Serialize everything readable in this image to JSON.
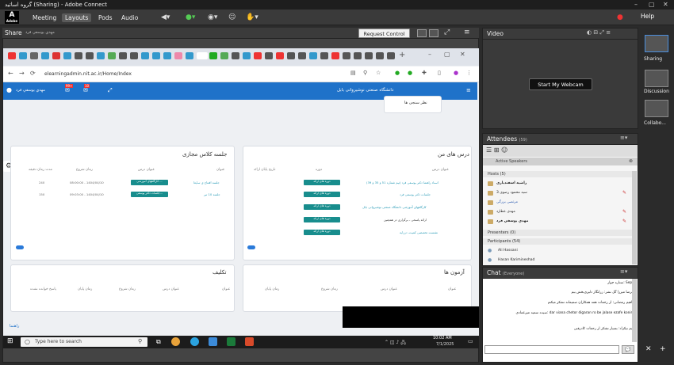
{
  "window": {
    "title": "گروه اساتید (Sharing) - Adobe Connect"
  },
  "app": {
    "logo": "Adobe"
  },
  "menu": {
    "meeting": "Meeting",
    "layouts": "Layouts",
    "pods": "Pods",
    "audio": "Audio",
    "help": "Help"
  },
  "share": {
    "title": "Share",
    "presenter": "مهدي یوسفي فرد",
    "request_control": "Request Control"
  },
  "browser": {
    "url": "elearningadmin.nit.ac.ir/Home/Index",
    "site_name": "دانشگاه صنعتی نوشیروانی بابل",
    "user_name": "مهدي يوسفي فرد",
    "badge_1": "99+",
    "badge_2": "10",
    "dropdown": "نظر سنجی ها"
  },
  "my_lessons": {
    "title": "درس های من",
    "headers": [
      "عنوان درس",
      "دوره",
      "تاریخ پایان ارائه"
    ],
    "rows": [
      "اسناد راهنما دکتر یوسفی فرد (تیم شماره 51 و 35 و 39)",
      "جلسات دکتر یوسفی فرد",
      "کارگاههای آموزشی دانشگاه صنعتی نوشیروانی بابل",
      "ارائه پاسخی - برگزاری در همچنین",
      "نشست تخصصی کمیت، درزایه"
    ],
    "button": "دوره های ارائه"
  },
  "virtual_class": {
    "title": "جلسه کلاس مجازی",
    "headers": [
      "عنوان",
      "عنوان درس",
      "زمان شروع",
      "مدت زمان دقیقه"
    ],
    "rows": [
      {
        "title": "جلسه افتتاح ی سایعا",
        "course": "کارگاههای آموزشی ...",
        "start": "08:00:00 - 1404/04/10",
        "duration": "240"
      },
      {
        "title": "جلسه 10 تیر",
        "course": "جلسات دکتر یوسفی...",
        "start": "09:03:00 - 1404/04/10",
        "duration": "150"
      }
    ]
  },
  "exams": {
    "title": "آزمون ها",
    "headers": [
      "عنوان",
      "عنوان درس",
      "زمان شروع",
      "زمان پایان"
    ]
  },
  "homework": {
    "title": "تکلیف",
    "headers": [
      "عنوان",
      "عنوان درس",
      "زمان شروع",
      "زمان پایان",
      "پاسخ خوانده نشده"
    ]
  },
  "footer_link": "راهنما",
  "taskbar": {
    "search_placeholder": "Type here to search",
    "time": "10:02 AM",
    "date": "7/1/2025"
  },
  "video": {
    "title": "Video",
    "start_webcam": "Start My Webcam"
  },
  "attendees": {
    "title": "Attendees",
    "count": "(59)",
    "active_speakers": "Active Speakers",
    "hosts_label": "Hosts (5)",
    "hosts": [
      "راضیه اسفندیاری",
      "سید محمود رضوی 3",
      "مرتضی بزرگی",
      "مهدی عطارد",
      "مهدي يوسفي فرد"
    ],
    "presenters_label": "Presenters (0)",
    "participants_label": "Participants (54)",
    "participants": [
      "Ali Hassani",
      "Hasan Karimineshad"
    ]
  },
  "chat": {
    "title": "Chat",
    "scope": "(Everyone)",
    "messages": [
      "ستاره جوار: Sepas",
      "علیرضا میرزا گل نشر: زرانگار دلیری‌بخش بیم",
      "ابراهیم رمضانی: از زحمات همه همکاران صمیمانه تشکر میکنم",
      "سیده سمیه میرعمادی: dar viana chetor digaran ro be jalase ezafe konim?",
      "مریم نیکزاد: بسیار تشکر از زحمات کادرفنی"
    ]
  },
  "layouts": [
    "Sharing",
    "Discussion",
    "Collabo..."
  ]
}
